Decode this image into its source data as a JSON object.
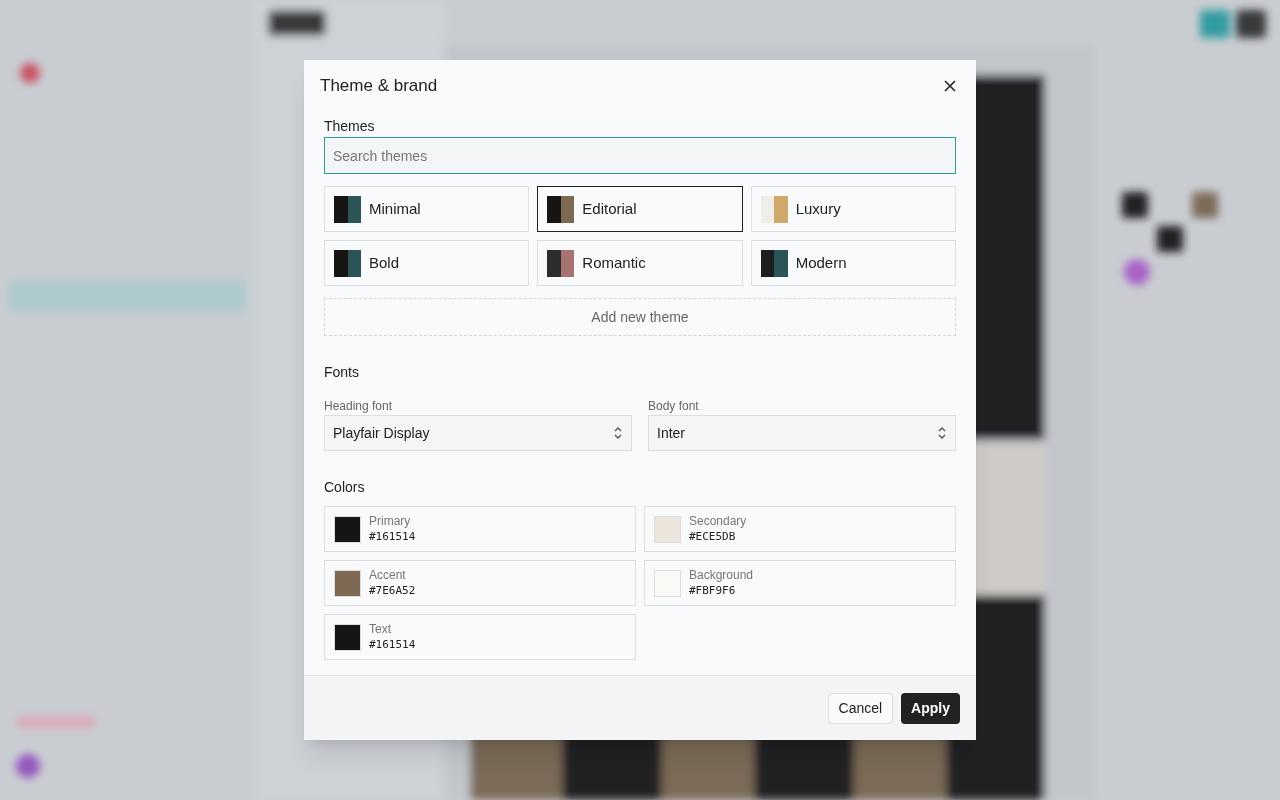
{
  "dialog": {
    "title": "Theme & brand",
    "themes": {
      "label": "Themes",
      "search": {
        "placeholder": "Search themes"
      },
      "items": [
        {
          "name": "Minimal",
          "selected": false,
          "swatch": [
            {
              "color": "#161514"
            },
            {
              "color": "#2c5558"
            }
          ]
        },
        {
          "name": "Editorial",
          "selected": true,
          "swatch": [
            {
              "color": "#161514"
            },
            {
              "color": "#7e6a52"
            }
          ]
        },
        {
          "name": "Luxury",
          "selected": false,
          "swatch": [
            {
              "color": "#efede8"
            },
            {
              "color": "#cfa86a"
            }
          ]
        },
        {
          "name": "Bold",
          "selected": false,
          "swatch": [
            {
              "color": "#161514"
            },
            {
              "color": "#2a5558"
            }
          ]
        },
        {
          "name": "Romantic",
          "selected": false,
          "swatch": [
            {
              "color": "#2e2d2d"
            },
            {
              "color": "#a87272"
            }
          ]
        },
        {
          "name": "Modern",
          "selected": false,
          "swatch": [
            {
              "color": "#1d1d1d"
            },
            {
              "color": "#2a5558"
            }
          ]
        }
      ],
      "add_button": "Add new theme"
    },
    "fonts": {
      "label": "Fonts",
      "fields": [
        {
          "label": "Heading font",
          "value": "Playfair Display"
        },
        {
          "label": "Body font",
          "value": "Inter"
        }
      ]
    },
    "colors": {
      "label": "Colors",
      "items": [
        {
          "name": "Primary",
          "hex": "#161514",
          "color": "#161514"
        },
        {
          "name": "Secondary",
          "hex": "#ECE5DB",
          "color": "#ece5db"
        },
        {
          "name": "Accent",
          "hex": "#7E6A52",
          "color": "#7e6a52"
        },
        {
          "name": "Background",
          "hex": "#FBF9F6",
          "color": "#fbf9f6"
        },
        {
          "name": "Text",
          "hex": "#161514",
          "color": "#161514"
        }
      ]
    },
    "buttons": {
      "cancel": "Cancel",
      "apply": "Apply"
    }
  }
}
